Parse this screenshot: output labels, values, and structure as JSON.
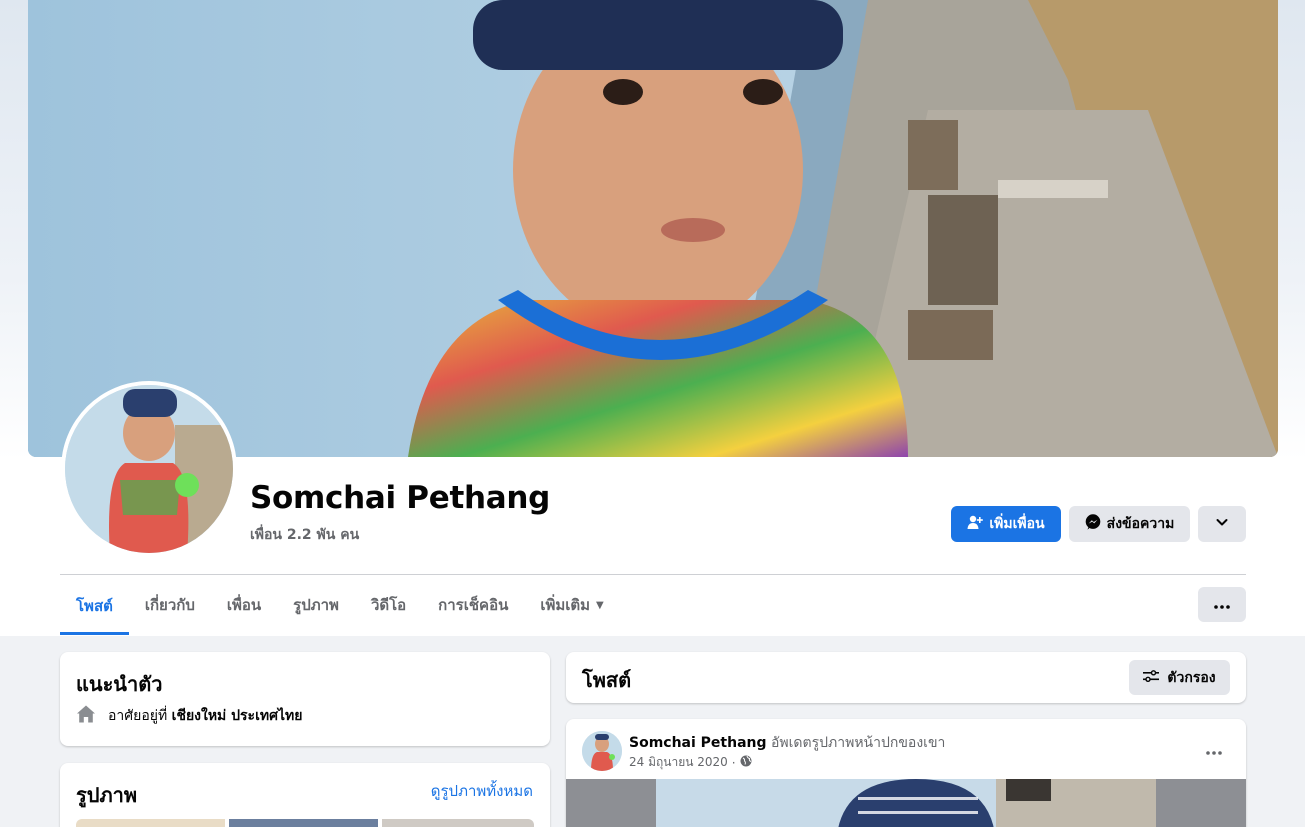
{
  "profile": {
    "name": "Somchai Pethang",
    "friends_count": "เพื่อน 2.2 พัน คน"
  },
  "actions": {
    "add_friend": "เพิ่มเพื่อน",
    "message": "ส่งข้อความ"
  },
  "tabs": [
    {
      "label": "โพสต์",
      "active": true
    },
    {
      "label": "เกี่ยวกับ"
    },
    {
      "label": "เพื่อน"
    },
    {
      "label": "รูปภาพ"
    },
    {
      "label": "วิดีโอ"
    },
    {
      "label": "การเช็คอิน"
    },
    {
      "label": "เพิ่มเติม"
    }
  ],
  "intro": {
    "title": "แนะนำตัว",
    "lives_in_prefix": "อาศัยอยู่ที่",
    "lives_in_place": "เชียงใหม่ ประเทศไทย"
  },
  "photos": {
    "title": "รูปภาพ",
    "see_all": "ดูรูปภาพทั้งหมด"
  },
  "posts_header": {
    "title": "โพสต์",
    "filter_label": "ตัวกรอง"
  },
  "post": {
    "author": "Somchai Pethang",
    "action": "อัพเดตรูปภาพหน้าปกของเขา",
    "date": "24 มิถุนายน 2020",
    "separator": "·"
  },
  "colors": {
    "accent": "#1b74e4",
    "secondary_button": "#e4e6eb",
    "muted_text": "#65676b",
    "background": "#f0f2f5"
  },
  "icons": [
    "add-person-icon",
    "messenger-icon",
    "chevron-down-icon",
    "more-icon",
    "home-icon",
    "filter-icon",
    "globe-icon"
  ]
}
